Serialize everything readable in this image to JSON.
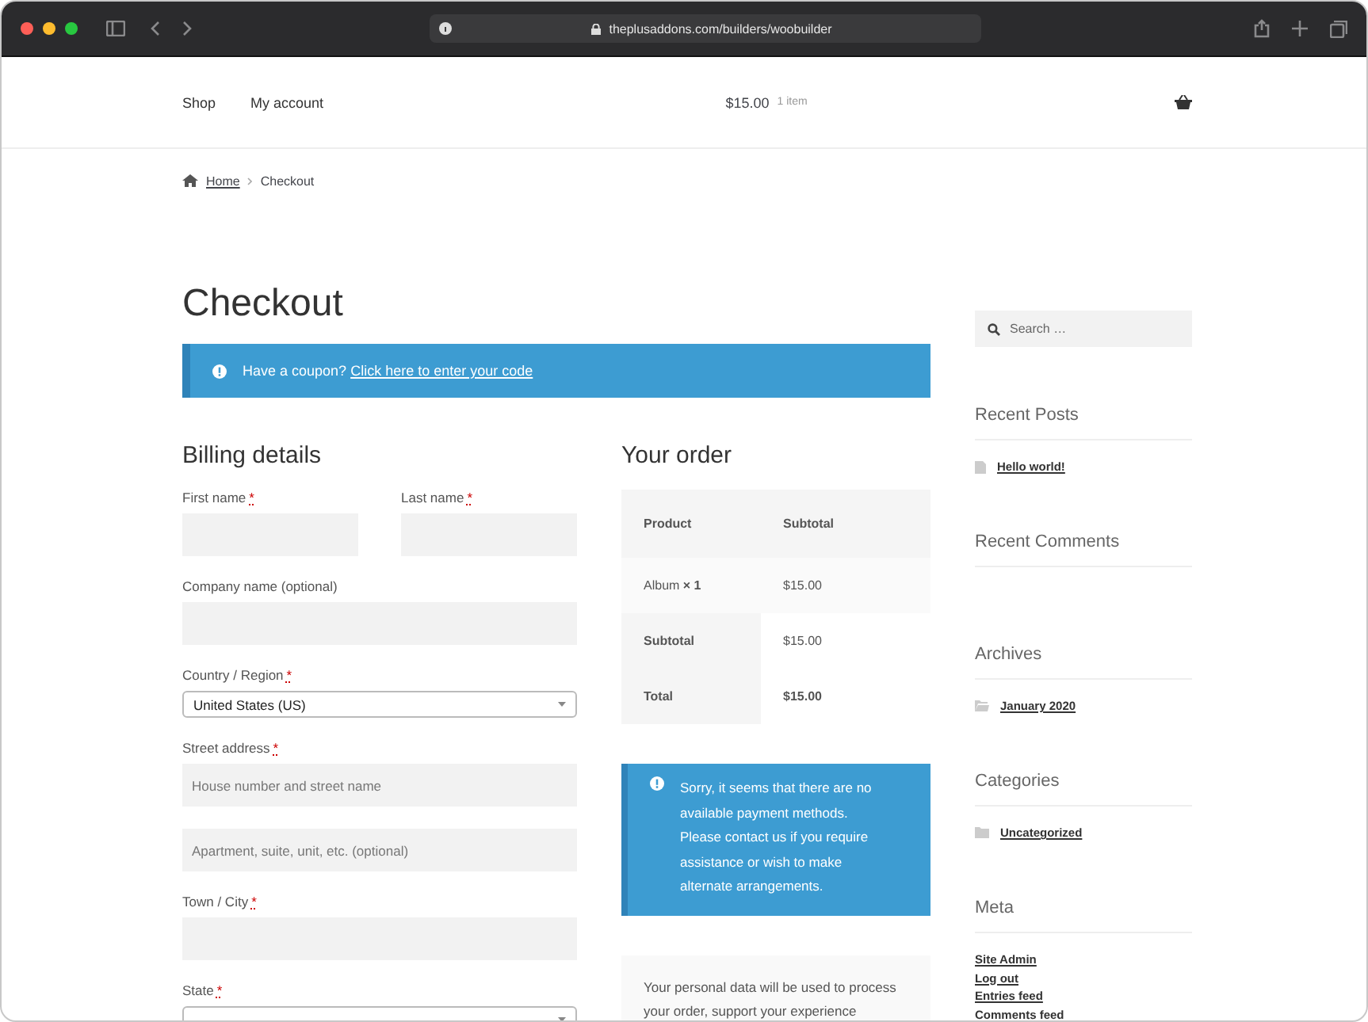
{
  "browser": {
    "url": "theplusaddons.com/builders/woobuilder"
  },
  "header": {
    "nav": [
      "Shop",
      "My account"
    ],
    "cart_total": "$15.00",
    "cart_count": "1 item"
  },
  "breadcrumb": [
    "Home",
    "Checkout"
  ],
  "page_title": "Checkout",
  "coupon_notice": {
    "text": "Have a coupon?",
    "link": "Click here to enter your code"
  },
  "billing": {
    "title": "Billing details",
    "fields": [
      {
        "kind": "half",
        "label": "First name",
        "mark": "*"
      },
      {
        "kind": "half",
        "label": "Last name",
        "mark": "*"
      },
      {
        "kind": "full",
        "label": "Company name (optional)"
      },
      {
        "kind": "select",
        "label": "Country / Region",
        "mark": "*",
        "value": "United States (US)"
      },
      {
        "kind": "full",
        "label": "Street address",
        "mark": "*",
        "placeholder": "House number and street name"
      },
      {
        "kind": "full",
        "placeholder": "Apartment, suite, unit, etc. (optional)"
      },
      {
        "kind": "full",
        "label": "Town / City",
        "mark": "*"
      },
      {
        "kind": "select",
        "label": "State",
        "mark": "*"
      }
    ]
  },
  "order": {
    "title": "Your order",
    "columns": [
      "Product",
      "Subtotal"
    ],
    "rows": [
      {
        "kind": "item",
        "cells": [
          "Album **× 1**",
          "$15.00"
        ]
      },
      {
        "kind": "subtotal",
        "cells": [
          "Subtotal",
          "$15.00"
        ]
      },
      {
        "kind": "total",
        "cells": [
          "Total",
          "$15.00"
        ]
      }
    ],
    "payment_notice": "Sorry, it seems that there are no available payment methods. Please contact us if you require assistance or wish to make alternate arrangements.",
    "privacy_text": "Your personal data will be used to process your order, support your experience"
  },
  "sidebar": {
    "search": {
      "placeholder": "Search …"
    },
    "widgets": [
      {
        "title": "Recent Posts",
        "items": [
          {
            "kind": "post",
            "label": "Hello world!"
          }
        ]
      },
      {
        "title": "Recent Comments"
      },
      {
        "title": "Archives",
        "items": [
          {
            "kind": "archive",
            "label": "January 2020"
          }
        ]
      },
      {
        "title": "Categories",
        "items": [
          {
            "kind": "category",
            "label": "Uncategorized"
          }
        ]
      },
      {
        "title": "Meta",
        "items": [
          {
            "kind": "link",
            "label": "Site Admin"
          },
          {
            "kind": "link",
            "label": "Log out"
          },
          {
            "kind": "link",
            "label": "Entries feed"
          },
          {
            "kind": "link",
            "label": "Comments feed"
          }
        ]
      }
    ]
  }
}
